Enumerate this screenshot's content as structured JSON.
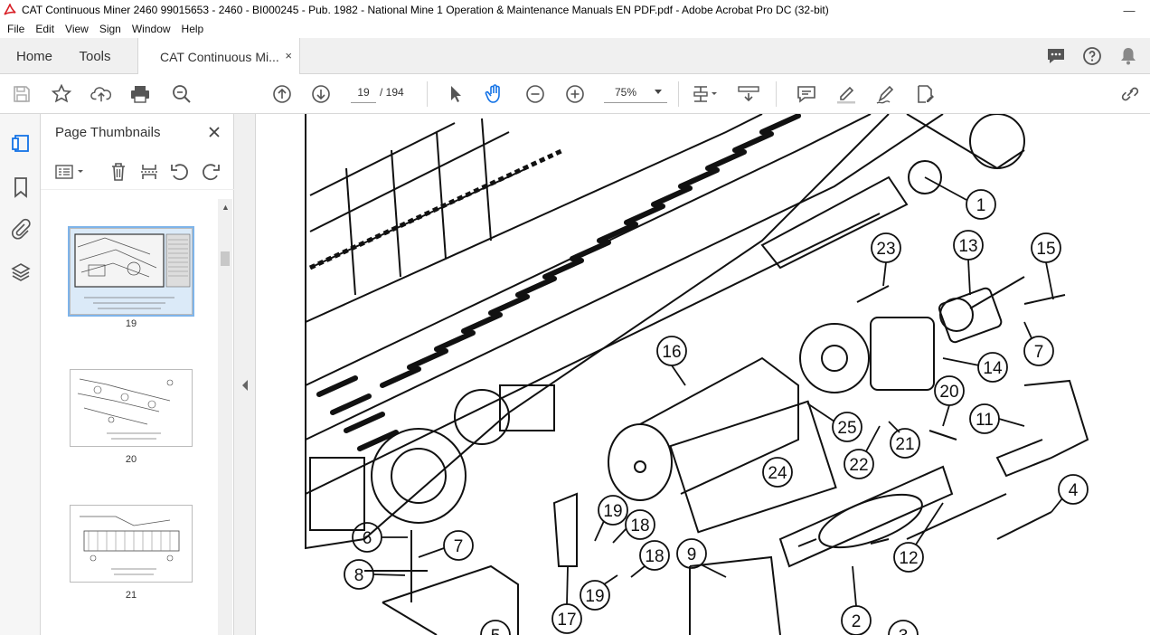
{
  "window": {
    "title": "CAT Continuous Miner 2460 99015653 - 2460 - BI000245 - Pub. 1982 - National Mine 1 Operation & Maintenance Manuals EN PDF.pdf - Adobe Acrobat Pro DC (32-bit)",
    "minimize": "—"
  },
  "menu": {
    "items": [
      "File",
      "Edit",
      "View",
      "Sign",
      "Window",
      "Help"
    ]
  },
  "tabs": {
    "home": "Home",
    "tools": "Tools",
    "doc": "CAT Continuous Mi...",
    "close": "×"
  },
  "toolbar": {
    "page_current": "19",
    "page_total": "/ 194",
    "zoom": "75%"
  },
  "thumbnails": {
    "header": "Page Thumbnails",
    "close": "×",
    "pages": [
      {
        "label": "19",
        "selected": true
      },
      {
        "label": "20",
        "selected": false
      },
      {
        "label": "21",
        "selected": false
      }
    ]
  },
  "diagram": {
    "callouts": [
      "1",
      "23",
      "13",
      "15",
      "7",
      "16",
      "14",
      "20",
      "11",
      "25",
      "21",
      "22",
      "24",
      "4",
      "19",
      "18",
      "12",
      "6",
      "7",
      "8",
      "18",
      "9",
      "19",
      "17",
      "2",
      "3",
      "5"
    ]
  },
  "colors": {
    "accent": "#1473e6",
    "text": "#222222"
  }
}
